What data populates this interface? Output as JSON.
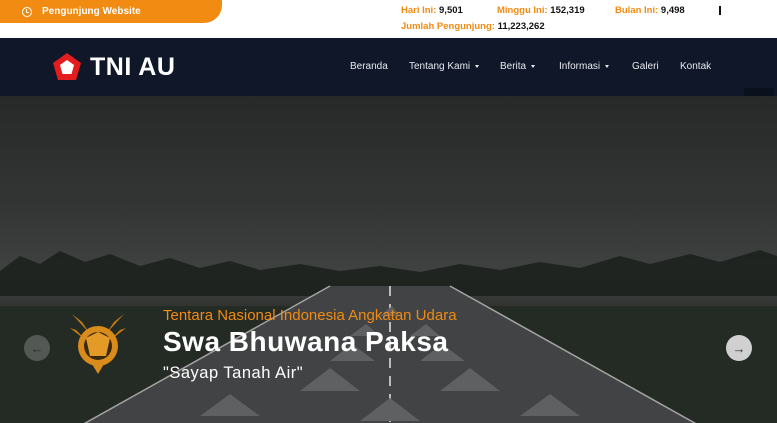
{
  "topbar": {
    "visitor_label": "Pengunjung Website",
    "stats": {
      "today_label": "Hari Ini:",
      "today_value": "9,501",
      "week_label": "Minggu Ini:",
      "week_value": "152,319",
      "month_label": "Bulan Ini:",
      "month_value": "9,498",
      "total_label": "Jumlah Pengunjung:",
      "total_value": "11,223,262"
    },
    "accent_color": "#f28b12"
  },
  "navbar": {
    "brand": "TNI AU",
    "menu": {
      "home": "Beranda",
      "about": "Tentang Kami",
      "news": "Berita",
      "info": "Informasi",
      "gallery": "Galeri",
      "contact": "Kontak"
    },
    "background_color": "#0f1728"
  },
  "hero": {
    "subtitle": "Tentara Nasional Indonesia Angkatan Udara",
    "title": "Swa Bhuwana Paksa",
    "motto": "\"Sayap Tanah Air\"",
    "prev_icon": "arrow-left-icon",
    "next_icon": "arrow-right-icon"
  }
}
